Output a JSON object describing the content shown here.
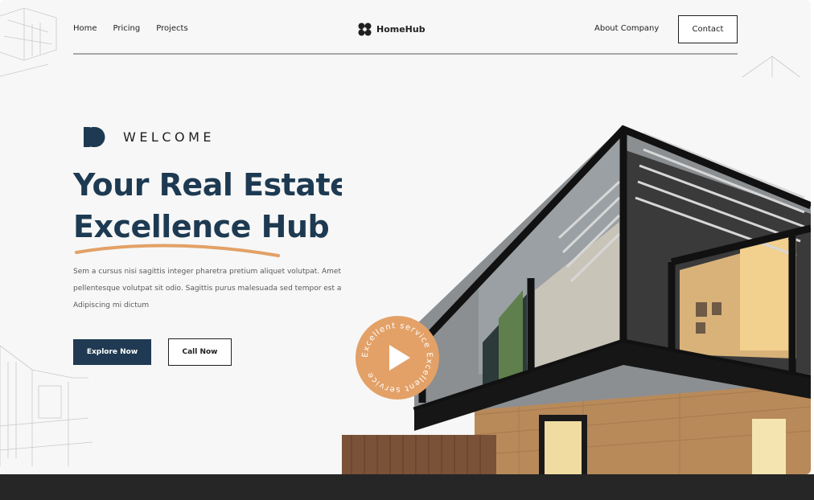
{
  "nav": {
    "links": [
      "Home",
      "Pricing",
      "Projects"
    ],
    "brand": "HomeHub",
    "about": "About Company",
    "contact": "Contact"
  },
  "hero": {
    "eyebrow": "WELCOME",
    "title_line1": "Your Real Estate",
    "title_line2": "Excellence Hub",
    "description": "Sem a cursus nisi sagittis integer pharetra pretium aliquet volutpat. Amet pellentesque volutpat sit odio. Sagittis purus malesuada sed tempor est at. Adipiscing mi dictum",
    "primary_button": "Explore Now",
    "secondary_button": "Call Now"
  },
  "badge": {
    "ring_text": "Excellent service Excellent service"
  },
  "icons": {
    "brand_logo": "four-leaf-logo-icon",
    "welcome_mark": "double-chevron-icon",
    "badge_play": "play-icon"
  },
  "colors": {
    "primary": "#1f3a52",
    "accent": "#e3a167",
    "background": "#f7f7f7",
    "footer": "#262626"
  }
}
